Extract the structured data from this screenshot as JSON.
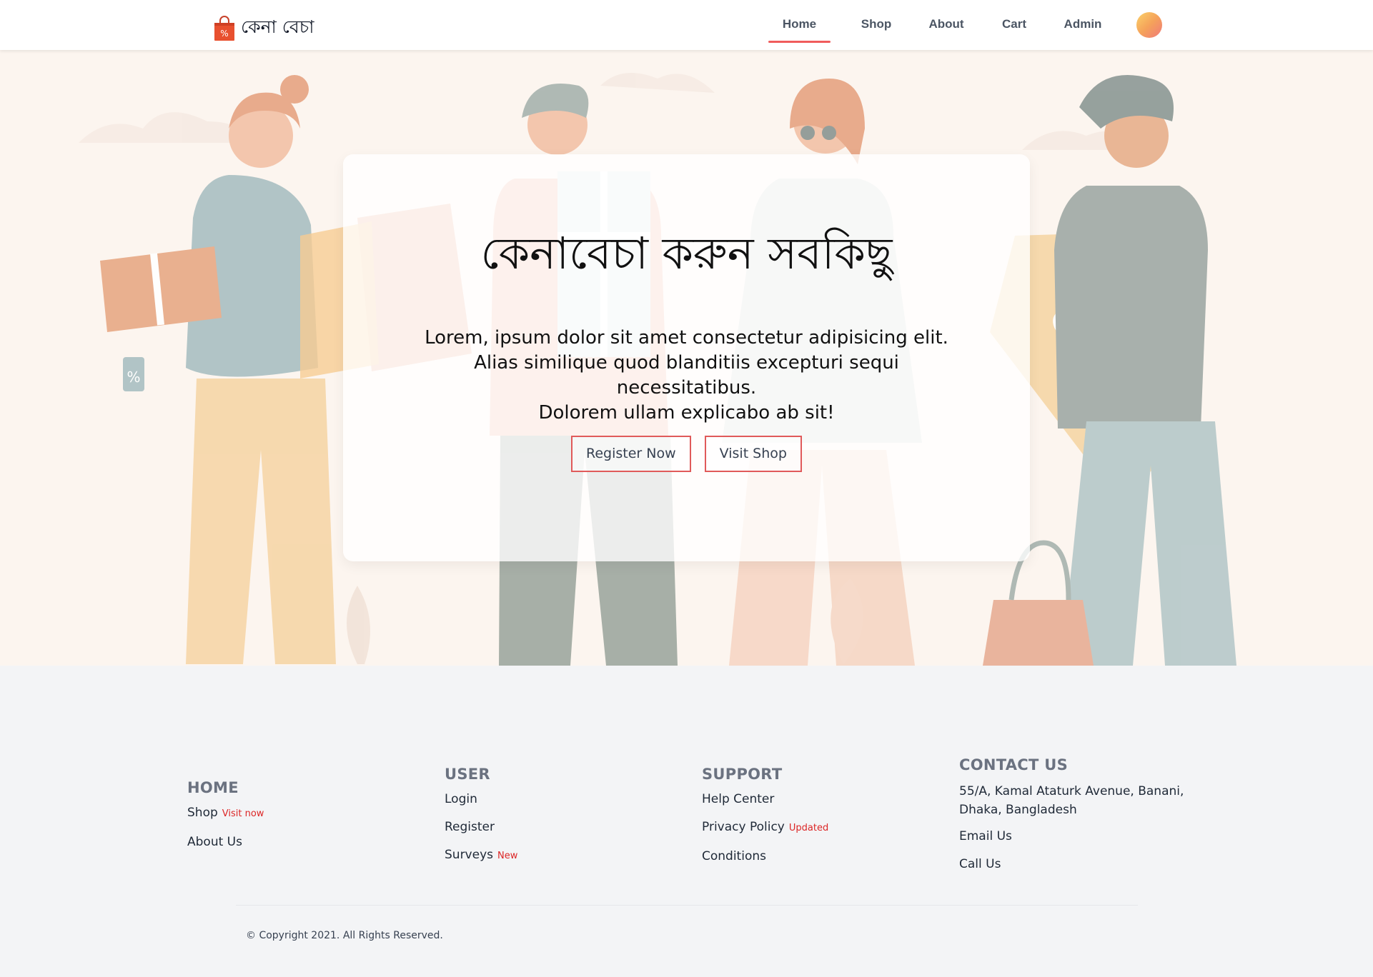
{
  "brand": {
    "name": "কেনা বেচা",
    "icon": "shopping-bag-percent-icon",
    "color": "#e8502f"
  },
  "nav": {
    "items": [
      {
        "label": "Home",
        "active": true
      },
      {
        "label": "Shop",
        "active": false
      },
      {
        "label": "About",
        "active": false
      },
      {
        "label": "Cart",
        "active": false
      },
      {
        "label": "Admin",
        "active": false
      }
    ],
    "active_color": "#f05c5c"
  },
  "hero": {
    "title": "কেনাবেচা করুন সবকিছু",
    "description_lines": [
      "Lorem, ipsum dolor sit amet consectetur adipisicing elit.",
      "Alias similique quod blanditiis excepturi sequi necessitatibus.",
      "Dolorem ullam explicabo ab sit!"
    ],
    "register_label": "Register Now",
    "visit_shop_label": "Visit Shop",
    "button_border_color": "#e05a5a"
  },
  "footer": {
    "home": {
      "heading": "HOME",
      "links": [
        {
          "label": "Shop",
          "tag": "Visit now"
        },
        {
          "label": "About Us",
          "tag": ""
        }
      ]
    },
    "user": {
      "heading": "USER",
      "links": [
        {
          "label": "Login",
          "tag": ""
        },
        {
          "label": "Register",
          "tag": ""
        },
        {
          "label": "Surveys",
          "tag": "New"
        }
      ]
    },
    "support": {
      "heading": "SUPPORT",
      "links": [
        {
          "label": "Help Center",
          "tag": ""
        },
        {
          "label": "Privacy Policy",
          "tag": "Updated"
        },
        {
          "label": "Conditions",
          "tag": ""
        }
      ]
    },
    "contact": {
      "heading": "CONTACT US",
      "address_line1": "55/A, Kamal Ataturk Avenue, Banani,",
      "address_line2": "Dhaka, Bangladesh",
      "links": [
        {
          "label": "Email Us"
        },
        {
          "label": "Call Us"
        }
      ]
    },
    "copyright": "© Copyright 2021. All Rights Reserved."
  }
}
